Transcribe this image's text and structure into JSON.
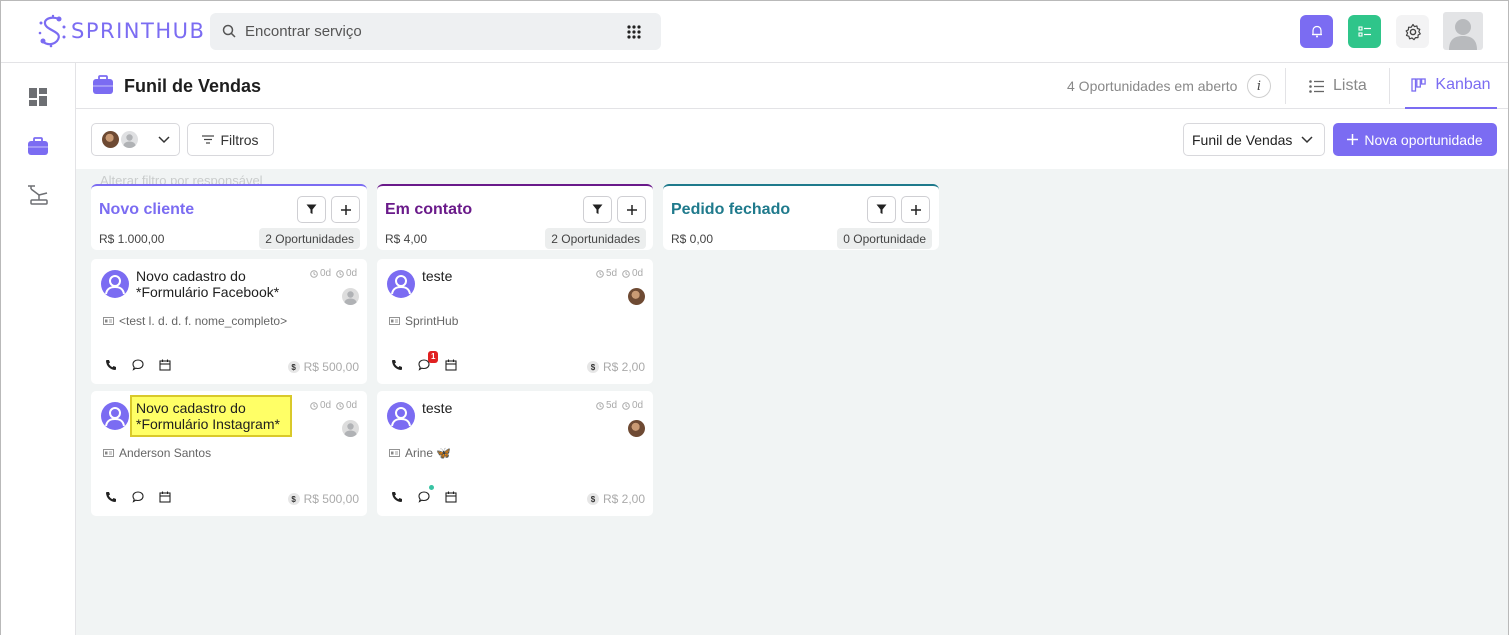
{
  "brand": {
    "name": "SPRINTHUB",
    "color": "#7b6cf2"
  },
  "search": {
    "placeholder": "Encontrar serviço"
  },
  "topbar": {
    "notify_color": "#7b6cf2",
    "tasks_color": "#2fc58a"
  },
  "page": {
    "title": "Funil de Vendas",
    "open_count": "4 Oportunidades em aberto",
    "info": "i",
    "tabs": [
      {
        "label": "Lista"
      },
      {
        "label": "Kanban"
      }
    ],
    "active_tab": "Kanban"
  },
  "toolbar": {
    "filters_label": "Filtros",
    "funnel_selected": "Funil de Vendas",
    "new_label": "Nova oportunidade",
    "responsible_hint": "Alterar filtro por responsável"
  },
  "columns": [
    {
      "title": "Novo cliente",
      "color": "#7b6cf2",
      "amount": "R$ 1.000,00",
      "count": "2 Oportunidades",
      "cards": [
        {
          "title": "Novo cadastro do *Formulário Facebook*",
          "highlighted": false,
          "time_a": "0d",
          "time_b": "0d",
          "owner": "placeholder",
          "sub": "<test l. d. d. f. nome_completo>",
          "value": "R$ 500,00",
          "chat_badge": "",
          "chat_dot": false
        },
        {
          "title": "Novo cadastro do *Formulário Instagram*",
          "highlighted": true,
          "time_a": "0d",
          "time_b": "0d",
          "owner": "placeholder",
          "sub": "Anderson Santos",
          "value": "R$ 500,00",
          "chat_badge": "",
          "chat_dot": false
        }
      ]
    },
    {
      "title": "Em contato",
      "color": "#6a1a8a",
      "amount": "R$ 4,00",
      "count": "2 Oportunidades",
      "cards": [
        {
          "title": "teste",
          "highlighted": false,
          "time_a": "5d",
          "time_b": "0d",
          "owner": "photo",
          "sub": "SprintHub",
          "value": "R$ 2,00",
          "chat_badge": "1",
          "chat_dot": false
        },
        {
          "title": "teste",
          "highlighted": false,
          "time_a": "5d",
          "time_b": "0d",
          "owner": "photo",
          "sub": "Arine 🦋",
          "value": "R$ 2,00",
          "chat_badge": "",
          "chat_dot": true
        }
      ]
    },
    {
      "title": "Pedido fechado",
      "color": "#1f7a8c",
      "amount": "R$ 0,00",
      "count": "0 Oportunidade",
      "cards": []
    }
  ]
}
